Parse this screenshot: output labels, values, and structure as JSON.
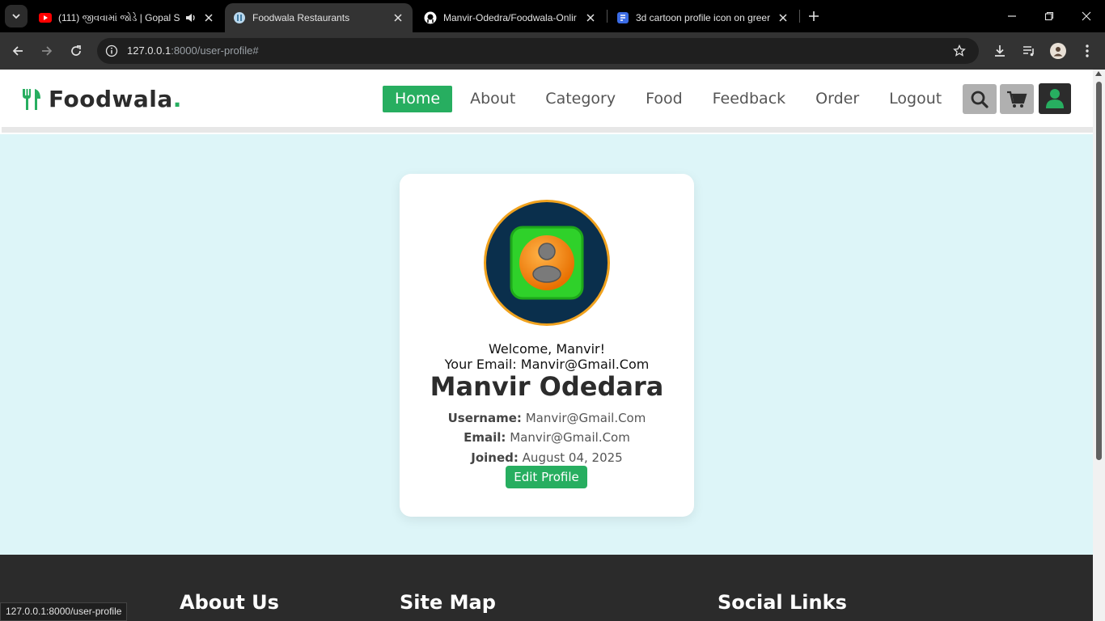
{
  "browser": {
    "tabs": [
      {
        "title": "(111) જીવવામાં જોડે | Gopal S",
        "favicon": "youtube-icon",
        "audio": true
      },
      {
        "title": "Foodwala Restaurants",
        "favicon": "site-icon",
        "active": true
      },
      {
        "title": "Manvir-Odedra/Foodwala-Onlir",
        "favicon": "github-icon"
      },
      {
        "title": "3d cartoon profile icon on greer",
        "favicon": "docs-icon"
      }
    ],
    "address": {
      "host": "127.0.0.1",
      "path": ":8000/user-profile#"
    },
    "status_url": "127.0.0.1:8000/user-profile"
  },
  "site": {
    "brand": "Foodwala",
    "brand_dot": ".",
    "nav": [
      {
        "label": "Home",
        "active": true
      },
      {
        "label": "About"
      },
      {
        "label": "Category"
      },
      {
        "label": "Food"
      },
      {
        "label": "Feedback"
      },
      {
        "label": "Order"
      },
      {
        "label": "Logout"
      }
    ],
    "accent_color": "#27ae60"
  },
  "profile": {
    "welcome": "Welcome, Manvir!",
    "your_email": "Your Email: Manvir@Gmail.Com",
    "full_name": "Manvir Odedara",
    "username_label": "Username:",
    "username": "Manvir@Gmail.Com",
    "email_label": "Email:",
    "email": "Manvir@Gmail.Com",
    "joined_label": "Joined:",
    "joined": "August 04, 2025",
    "edit_button": "Edit Profile"
  },
  "footer": {
    "about": "About Us",
    "sitemap": "Site Map",
    "social": "Social Links"
  }
}
